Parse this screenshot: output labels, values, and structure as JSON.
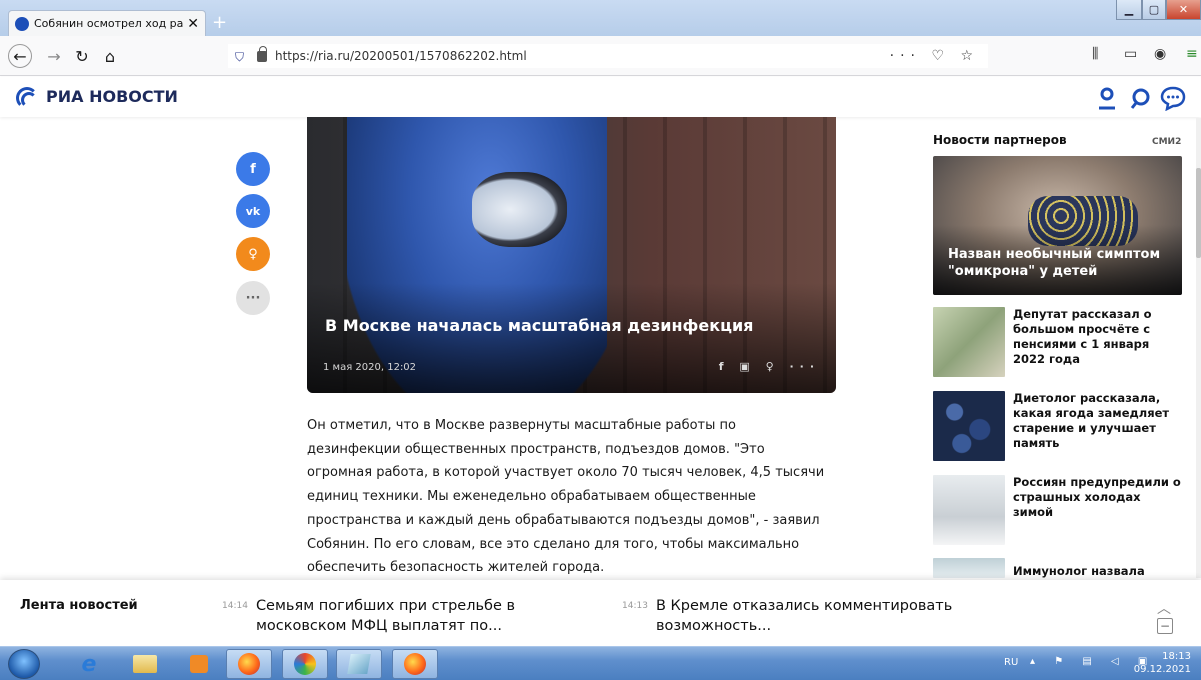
{
  "browser": {
    "tab_title": "Собянин осмотрел ход работ",
    "tab_close": "✕",
    "new_tab": "+",
    "url": "https://ria.ru/20200501/1570862202.html",
    "url_actions": "··· ♡ ☆"
  },
  "site": {
    "logo_text": "РИА НОВОСТИ"
  },
  "social": {
    "more": "···"
  },
  "hero": {
    "title": "В Москве началась масштабная дезинфекция",
    "date": "1 мая 2020, 12:02",
    "icons": "f ▣ ♀ ···"
  },
  "article": {
    "text": "Он отметил, что в Москве развернуты масштабные работы по дезинфекции общественных пространств, подъездов домов. \"Это огромная работа, в которой участвует около 70 тысяч человек, 4,5 тысячи единиц техники. Мы еженедельно обрабатываем общественные пространства и каждый день обрабатываются подъезды домов\", - заявил Собянин. По его словам, все это сделано для того, чтобы максимально обеспечить безопасность жителей города."
  },
  "partners": {
    "heading": "Новости партнеров",
    "badge": "СМИ2",
    "main_card": "Назван необычный симптом \"омикрона\" у детей",
    "items": [
      "Депутат рассказал о большом просчёте с пенсиями с 1 января 2022 года",
      "Диетолог рассказала, какая ягода замедляет старение и улучшает память",
      "Россиян предупредили о страшных холодах зимой",
      "Иммунолог назвала"
    ]
  },
  "ticker": {
    "label": "Лента новостей",
    "items": [
      {
        "time": "14:14",
        "headline": "Семьям погибших при стрельбе в московском МФЦ выплатят по..."
      },
      {
        "time": "14:13",
        "headline": "В Кремле отказались комментировать возможность..."
      }
    ]
  },
  "taskbar": {
    "lang": "RU",
    "time": "18:13",
    "date": "09.12.2021"
  }
}
